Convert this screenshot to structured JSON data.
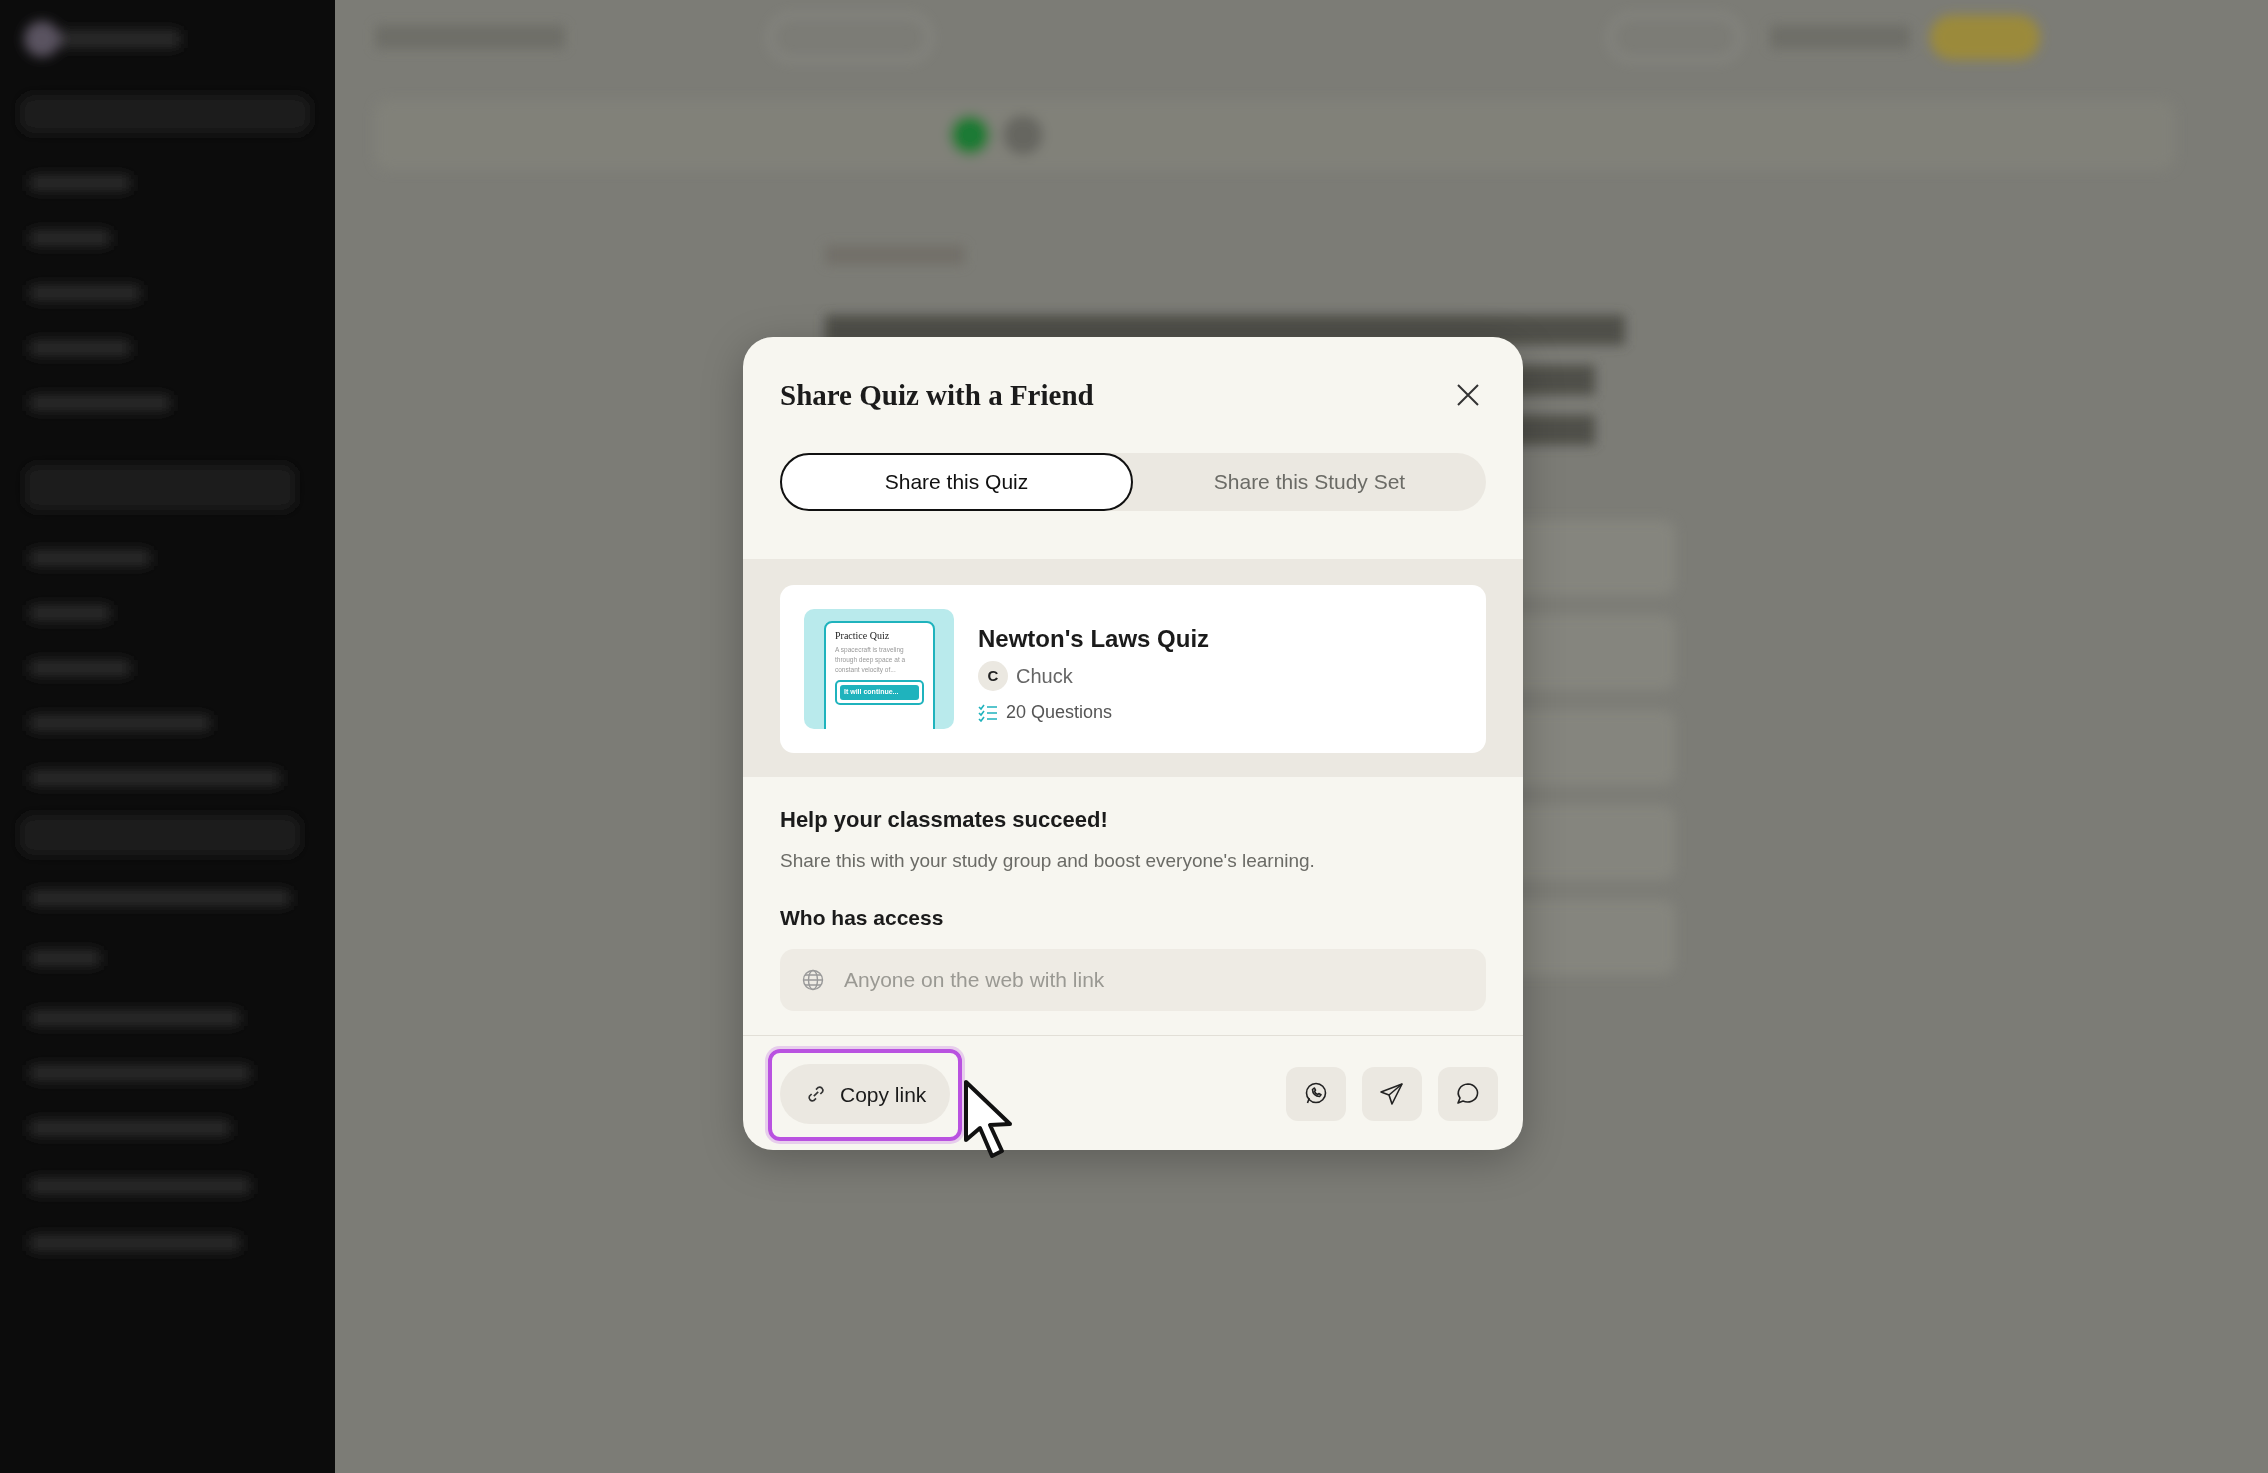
{
  "modal": {
    "title": "Share Quiz with a Friend",
    "tabs": [
      {
        "label": "Share this Quiz",
        "selected": true
      },
      {
        "label": "Share this Study Set",
        "selected": false
      }
    ],
    "quiz_card": {
      "thumbnail": {
        "title": "Practice Quiz",
        "text": "A spacecraft is traveling through deep space at a constant velocity of...",
        "answer": "It will continue..."
      },
      "title": "Newton's Laws Quiz",
      "author_initial": "C",
      "author": "Chuck",
      "questions": "20 Questions"
    },
    "heading": "Help your classmates succeed!",
    "description": "Share this with your study group and boost everyone's learning.",
    "access_label": "Who has access",
    "access_field": {
      "placeholder": "Anyone on the web with link"
    },
    "copy_link": {
      "label": "Copy link",
      "highlighted": true
    },
    "share_buttons": [
      {
        "kind": "whatsapp"
      },
      {
        "kind": "send"
      },
      {
        "kind": "message"
      }
    ]
  }
}
